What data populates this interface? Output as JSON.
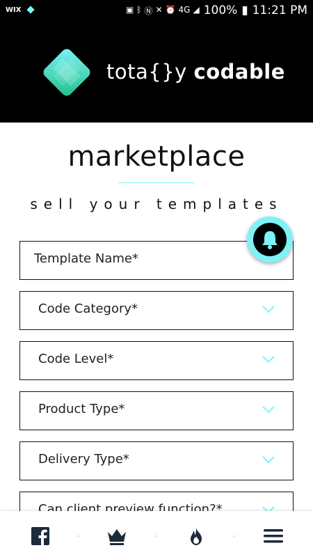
{
  "status_bar": {
    "wix_label": "WIX",
    "battery": "100%",
    "time": "11:21 PM",
    "network": "4G"
  },
  "header": {
    "logo_text_light": "tota{}y",
    "logo_text_bold": "codable",
    "brand_colors": {
      "teal": "#2fd3c4",
      "cyan": "#7ef3f6"
    }
  },
  "page": {
    "title": "marketplace",
    "subtitle": "sell your templates"
  },
  "form": {
    "fields": [
      {
        "label": "Template Name*",
        "type": "text"
      },
      {
        "label": "Code Category*",
        "type": "select"
      },
      {
        "label": "Code Level*",
        "type": "select"
      },
      {
        "label": "Product Type*",
        "type": "select"
      },
      {
        "label": "Delivery Type*",
        "type": "select"
      },
      {
        "label": "Can client preview function?*",
        "type": "select"
      }
    ]
  },
  "bottom_nav": {
    "items": [
      "facebook-icon",
      "crown-icon",
      "flame-icon",
      "menu-icon"
    ]
  },
  "colors": {
    "accent": "#7ef3f6",
    "header_bg": "#000000"
  }
}
